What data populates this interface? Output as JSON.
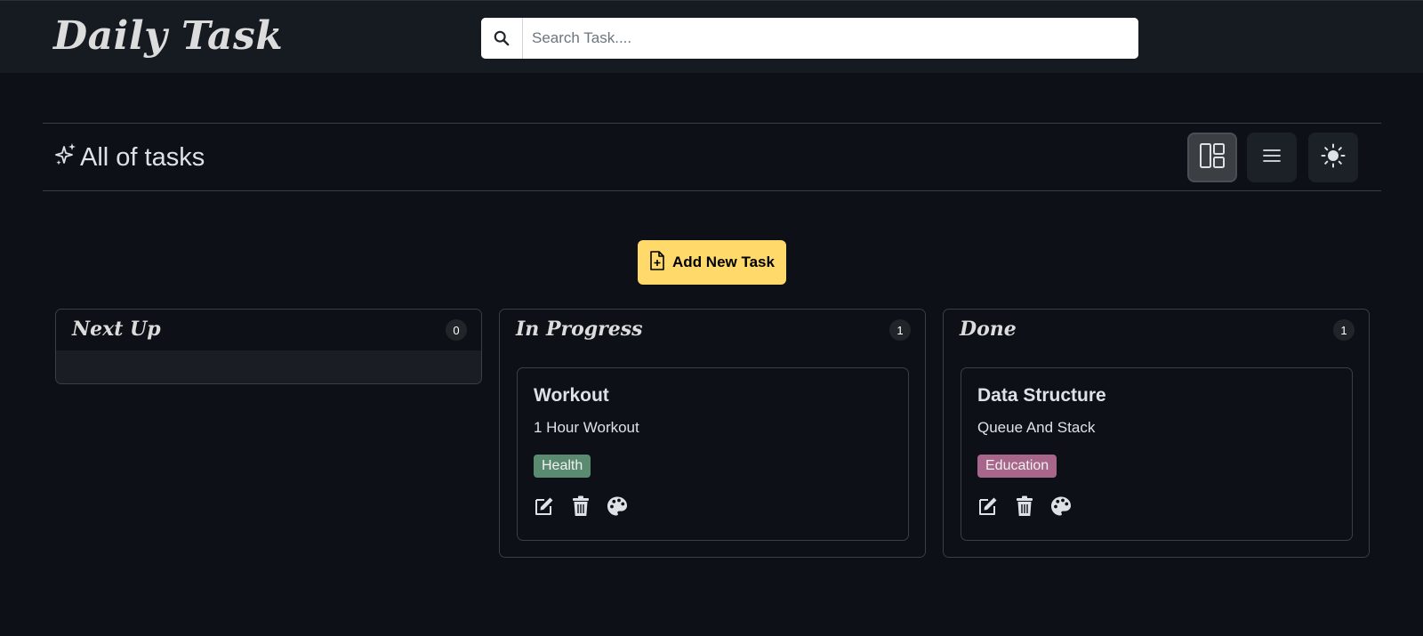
{
  "app": {
    "brand": "Daily Task"
  },
  "search": {
    "placeholder": "Search Task...."
  },
  "toolbar": {
    "title": "All of tasks"
  },
  "buttons": {
    "add_task": "Add New Task"
  },
  "colors": {
    "accent": "#ffda6a",
    "health_tag": "#5a8a70",
    "education_tag": "#a8668a"
  },
  "columns": [
    {
      "title": "Next Up",
      "count": "0",
      "tasks": []
    },
    {
      "title": "In Progress",
      "count": "1",
      "tasks": [
        {
          "title": "Workout",
          "description": "1 Hour Workout",
          "tag": "Health"
        }
      ]
    },
    {
      "title": "Done",
      "count": "1",
      "tasks": [
        {
          "title": "Data Structure",
          "description": "Queue And Stack",
          "tag": "Education"
        }
      ]
    }
  ],
  "icons": {
    "search": "search-icon",
    "sparkle": "sparkles-icon",
    "grid_view": "columns-layout-icon",
    "list_view": "list-icon",
    "theme": "sun-icon",
    "add": "file-plus-icon",
    "edit": "edit-icon",
    "delete": "trash-icon",
    "color": "palette-icon"
  }
}
